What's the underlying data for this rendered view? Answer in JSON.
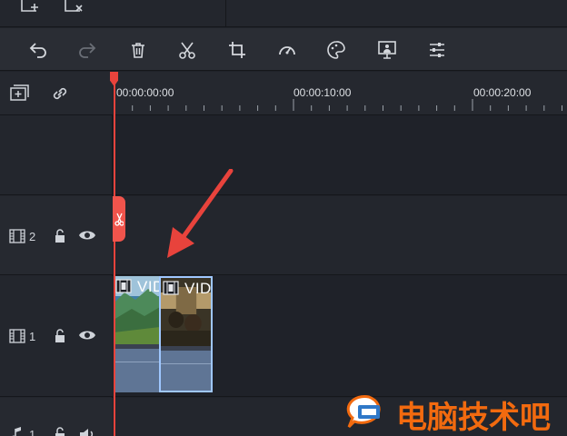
{
  "toolbar": {
    "tools": [
      {
        "name": "undo-icon",
        "enabled": true
      },
      {
        "name": "redo-icon",
        "enabled": false
      },
      {
        "name": "delete-icon",
        "enabled": true
      },
      {
        "name": "cut-icon",
        "enabled": true
      },
      {
        "name": "crop-icon",
        "enabled": true
      },
      {
        "name": "speed-icon",
        "enabled": true
      },
      {
        "name": "color-icon",
        "enabled": true
      },
      {
        "name": "green-screen-icon",
        "enabled": true
      },
      {
        "name": "adjust-icon",
        "enabled": true
      }
    ]
  },
  "ruler": {
    "timecodes": [
      "00:00:00:00",
      "00:00:10:00",
      "00:00:20:00"
    ]
  },
  "tracks": [
    {
      "number": "2",
      "type": "video"
    },
    {
      "number": "1",
      "type": "video"
    },
    {
      "number": "1",
      "type": "audio"
    }
  ],
  "clips": [
    {
      "title": "VIDEO",
      "selected": false
    },
    {
      "title": "VIDEO",
      "selected": true
    }
  ],
  "watermark": {
    "text": "电脑技术吧"
  },
  "colors": {
    "playhead": "#e8433c",
    "clip": "#5f7595",
    "selection": "#9fc7ff",
    "arrow": "#e8433c",
    "watermark": "#f26a0f"
  }
}
